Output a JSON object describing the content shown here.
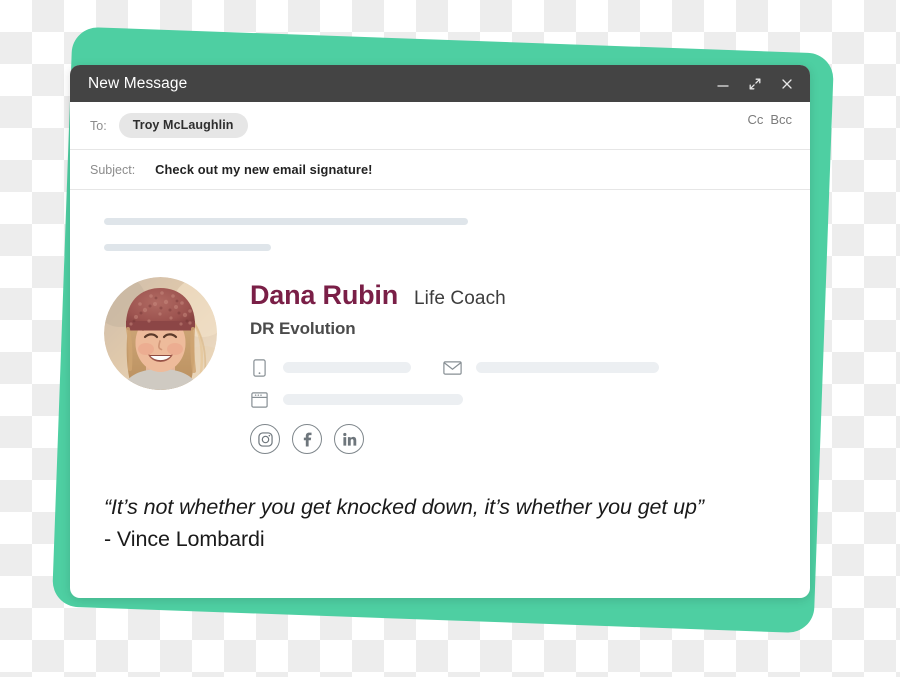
{
  "decor": {
    "accent_green": "#4ECFA2"
  },
  "window": {
    "title": "New Message",
    "controls": {
      "minimize": "minimize-icon",
      "expand": "expand-icon",
      "close": "close-icon"
    }
  },
  "compose": {
    "to_label": "To:",
    "recipient": "Troy McLaughlin",
    "cc_label": "Cc",
    "bcc_label": "Bcc",
    "subject_label": "Subject:",
    "subject_value": "Check out my new email signature!"
  },
  "signature": {
    "name": "Dana Rubin",
    "name_color": "#7A1F47",
    "role": "Life Coach",
    "company": "DR Evolution",
    "avatar_alt": "portrait of smiling woman in knit beanie",
    "contacts": [
      {
        "icon": "phone-icon",
        "value": ""
      },
      {
        "icon": "email-icon",
        "value": ""
      },
      {
        "icon": "website-icon",
        "value": ""
      }
    ],
    "social": [
      {
        "icon": "instagram-icon",
        "label": "Instagram"
      },
      {
        "icon": "facebook-icon",
        "label": "Facebook"
      },
      {
        "icon": "linkedin-icon",
        "label": "LinkedIn"
      }
    ]
  },
  "quote": {
    "text": "“It’s not whether you get knocked down, it’s whether you get up”",
    "author": "- Vince Lombardi"
  }
}
